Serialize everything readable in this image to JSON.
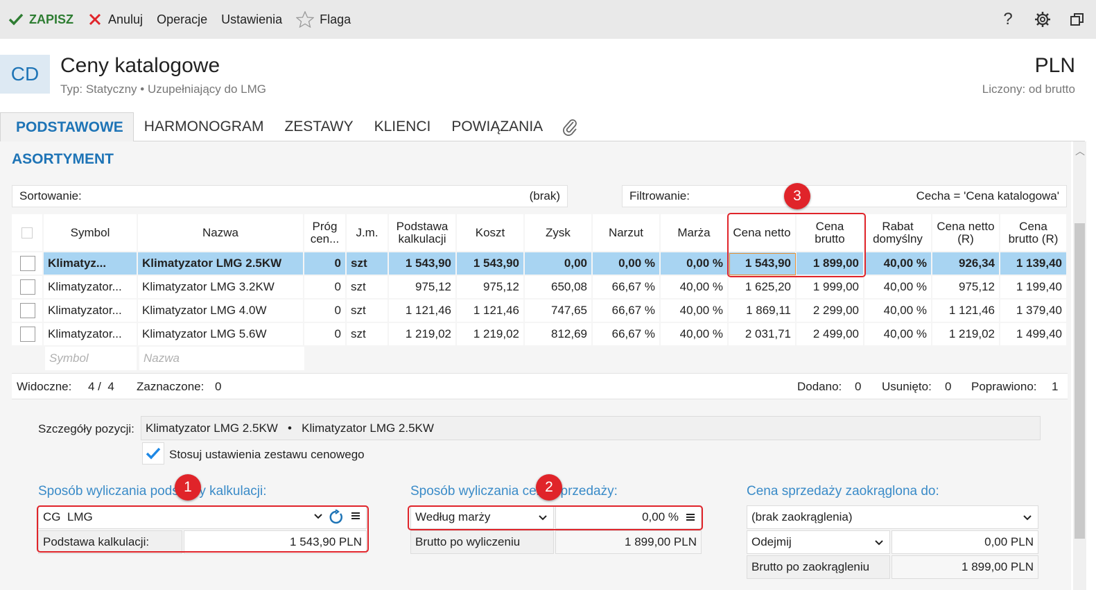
{
  "toolbar": {
    "save": "ZAPISZ",
    "cancel": "Anuluj",
    "operations": "Operacje",
    "settings": "Ustawienia",
    "flag": "Flaga",
    "help": "?"
  },
  "header": {
    "badge": "CD",
    "title": "Ceny katalogowe",
    "subtitle": "Typ: Statyczny • Uzupełniający do LMG",
    "currency": "PLN",
    "currency_sub": "Liczony: od brutto"
  },
  "tabs": [
    "PODSTAWOWE",
    "HARMONOGRAM",
    "ZESTAWY",
    "KLIENCI",
    "POWIĄZANIA"
  ],
  "section_title": "ASORTYMENT",
  "sort": {
    "label": "Sortowanie:",
    "value": "(brak)"
  },
  "filter": {
    "label": "Filtrowanie:",
    "value": "Cecha = 'Cena katalogowa'"
  },
  "grid": {
    "columns": [
      "Symbol",
      "Nazwa",
      "Próg cen...",
      "J.m.",
      "Podstawa kalkulacji",
      "Koszt",
      "Zysk",
      "Narzut",
      "Marża",
      "Cena netto",
      "Cena brutto",
      "Rabat domyślny",
      "Cena netto (R)",
      "Cena brutto (R)"
    ],
    "rows": [
      [
        "Klimatyz...",
        "Klimatyzator LMG 2.5KW",
        "0",
        "szt",
        "1 543,90",
        "1 543,90",
        "0,00",
        "0,00 %",
        "0,00 %",
        "1 543,90",
        "1 899,00",
        "40,00 %",
        "926,34",
        "1 139,40"
      ],
      [
        "Klimatyzator...",
        "Klimatyzator LMG 3.2KW",
        "0",
        "szt",
        "975,12",
        "975,12",
        "650,08",
        "66,67 %",
        "40,00 %",
        "1 625,20",
        "1 999,00",
        "40,00 %",
        "975,12",
        "1 199,40"
      ],
      [
        "Klimatyzator...",
        "Klimatyzator LMG 4.0W",
        "0",
        "szt",
        "1 121,46",
        "1 121,46",
        "747,65",
        "66,67 %",
        "40,00 %",
        "1 869,11",
        "2 299,00",
        "40,00 %",
        "1 121,46",
        "1 379,40"
      ],
      [
        "Klimatyzator...",
        "Klimatyzator LMG 5.6W",
        "0",
        "szt",
        "1 219,02",
        "1 219,02",
        "812,69",
        "66,67 %",
        "40,00 %",
        "2 031,71",
        "2 499,00",
        "40,00 %",
        "1 219,02",
        "1 499,40"
      ]
    ],
    "filter_symbol_placeholder": "Symbol",
    "filter_name_placeholder": "Nazwa"
  },
  "status": {
    "visible_label": "Widoczne:",
    "visible_value": "4 /  4",
    "selected_label": "Zaznaczone:",
    "selected_value": "0",
    "added_label": "Dodano:",
    "added_value": "0",
    "removed_label": "Usunięto:",
    "removed_value": "0",
    "fixed_label": "Poprawiono:",
    "fixed_value": "1"
  },
  "details": {
    "position_label": "Szczegóły pozycji:",
    "position_value": "Klimatyzator LMG 2.5KW   •   Klimatyzator LMG 2.5KW",
    "apply_set_label": "Stosuj ustawienia zestawu cenowego",
    "base_title": "Sposób wyliczania podstawy kalkulacji:",
    "base_select": "CG  LMG",
    "base_label": "Podstawa kalkulacji:",
    "base_value": "1 543,90 PLN",
    "sale_title": "Sposób wyliczania ceny sprzedaży:",
    "sale_select": "Według marży",
    "sale_value": "0,00 %",
    "gross_label": "Brutto po wyliczeniu",
    "gross_value": "1 899,00 PLN",
    "round_title": "Cena sprzedaży zaokrąglona do:",
    "round_select": "(brak zaokrąglenia)",
    "round_op": "Odejmij",
    "round_op_value": "0,00 PLN",
    "round_gross_label": "Brutto po zaokrągleniu",
    "round_gross_value": "1 899,00 PLN"
  },
  "callouts": [
    "1",
    "2",
    "3"
  ],
  "colors": {
    "accent": "#1e74b6",
    "selected_row": "#a8d4f2",
    "callout": "#e0242a",
    "save": "#2e7d32"
  }
}
